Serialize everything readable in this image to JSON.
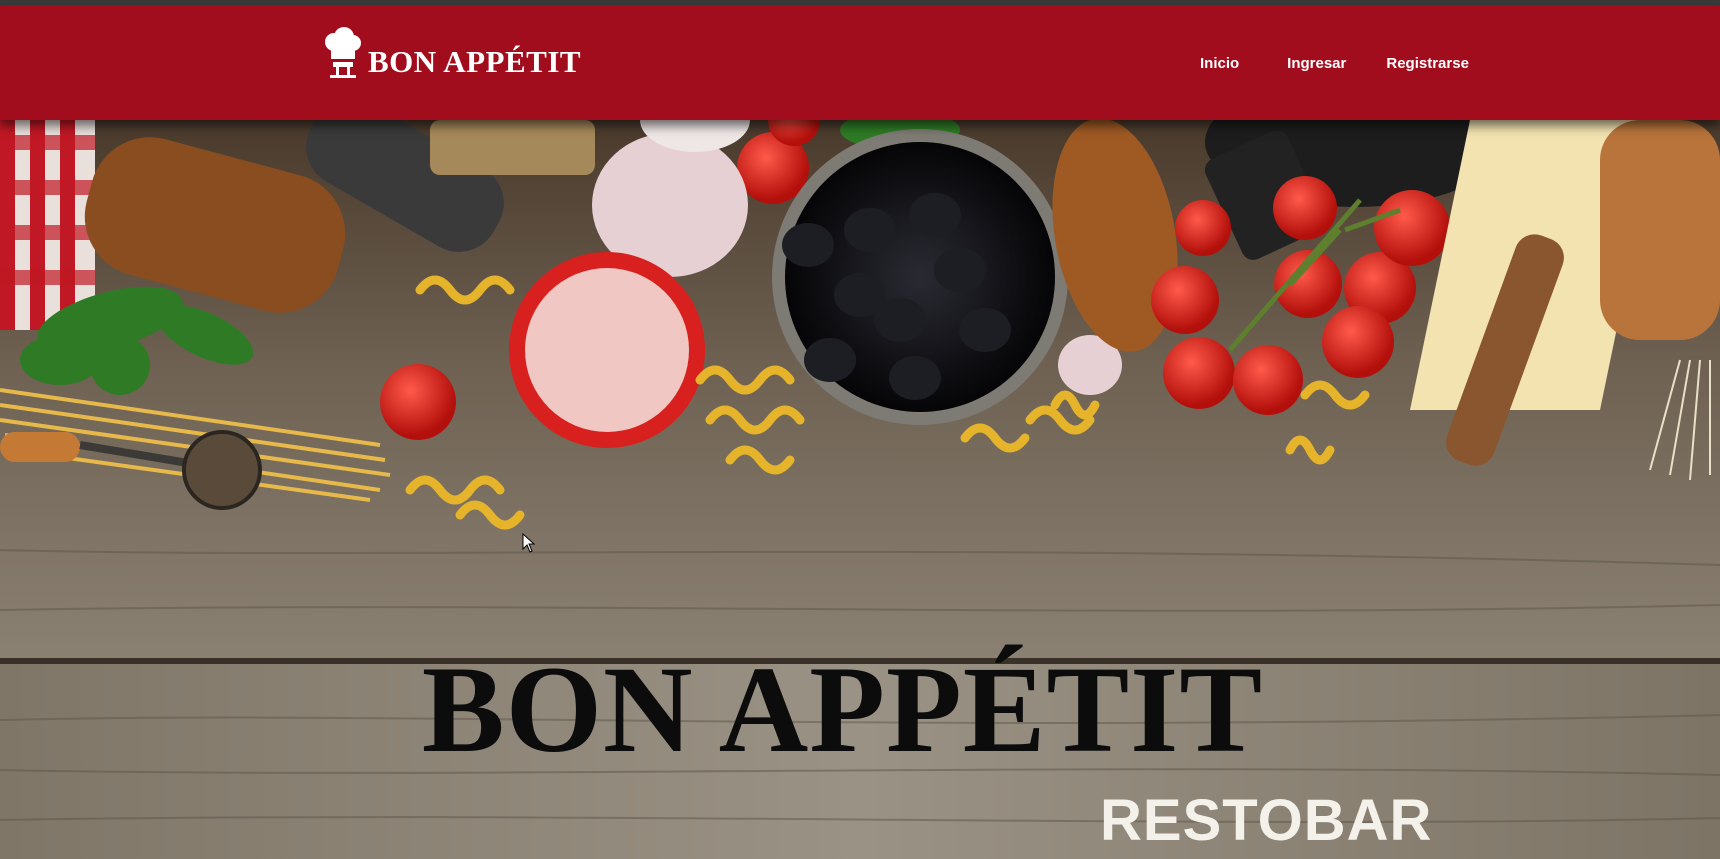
{
  "brand": {
    "name": "BON APPÉTIT",
    "logo_icon": "chef-hat-icon"
  },
  "nav": {
    "items": [
      {
        "label": "Inicio"
      },
      {
        "label": "Ingresar"
      },
      {
        "label": "Registrarse"
      }
    ]
  },
  "hero": {
    "title": "BON APPÉTIT",
    "subtitle": "RESTOBAR",
    "background": "food-ingredients-on-wooden-table-image"
  },
  "colors": {
    "navbar_bg": "#a20d1e",
    "nav_text": "#ffffff",
    "hero_title": "#0c0c0c",
    "hero_subtitle": "#f4f1ea"
  }
}
